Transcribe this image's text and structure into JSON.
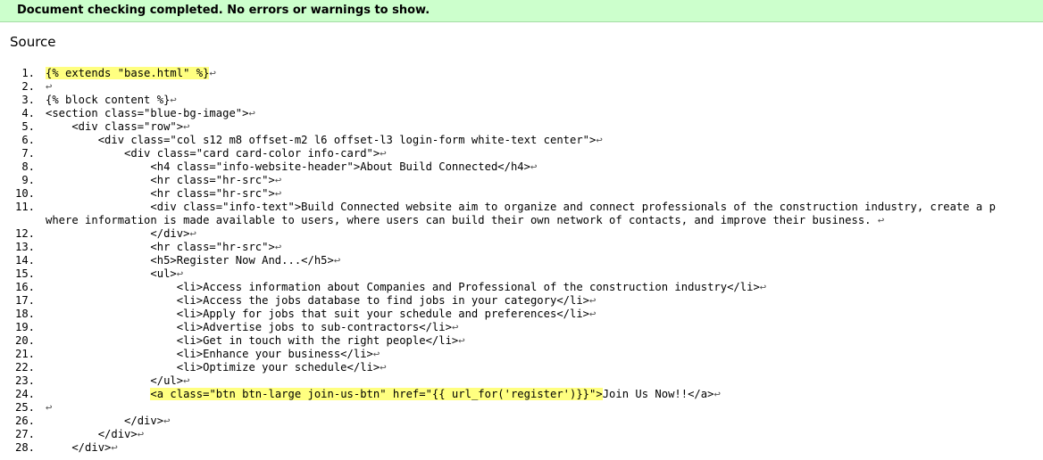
{
  "banner": {
    "message": "Document checking completed. No errors or warnings to show."
  },
  "source": {
    "heading": "Source",
    "return_glyph": "↩",
    "lines": [
      {
        "num": "1.",
        "text": "{% extends \"base.html\" %}",
        "highlight": true
      },
      {
        "num": "2.",
        "text": ""
      },
      {
        "num": "3.",
        "text": "{% block content %}"
      },
      {
        "num": "4.",
        "text": "<section class=\"blue-bg-image\">"
      },
      {
        "num": "5.",
        "text": "    <div class=\"row\">"
      },
      {
        "num": "6.",
        "text": "        <div class=\"col s12 m8 offset-m2 l6 offset-l3 login-form white-text center\">"
      },
      {
        "num": "7.",
        "text": "            <div class=\"card card-color info-card\">"
      },
      {
        "num": "8.",
        "text": "                <h4 class=\"info-website-header\">About Build Connected</h4>"
      },
      {
        "num": "9.",
        "text": "                <hr class=\"hr-src\">"
      },
      {
        "num": "10.",
        "text": "                <hr class=\"hr-src\">"
      },
      {
        "num": "11.",
        "text": "                <div class=\"info-text\">Build Connected website aim to organize and connect professionals of the construction industry, create a p",
        "continuation": "where information is made available to users, where users can build their own network of contacts, and improve their business. "
      },
      {
        "num": "12.",
        "text": "                </div>"
      },
      {
        "num": "13.",
        "text": "                <hr class=\"hr-src\">"
      },
      {
        "num": "14.",
        "text": "                <h5>Register Now And...</h5>"
      },
      {
        "num": "15.",
        "text": "                <ul>"
      },
      {
        "num": "16.",
        "text": "                    <li>Access information about Companies and Professional of the construction industry</li>"
      },
      {
        "num": "17.",
        "text": "                    <li>Access the jobs database to find jobs in your category</li>"
      },
      {
        "num": "18.",
        "text": "                    <li>Apply for jobs that suit your schedule and preferences</li>"
      },
      {
        "num": "19.",
        "text": "                    <li>Advertise jobs to sub-contractors</li>"
      },
      {
        "num": "20.",
        "text": "                    <li>Get in touch with the right people</li>"
      },
      {
        "num": "21.",
        "text": "                    <li>Enhance your business</li>"
      },
      {
        "num": "22.",
        "text": "                    <li>Optimize your schedule</li>"
      },
      {
        "num": "23.",
        "text": "                </ul>"
      },
      {
        "num": "24.",
        "text": "                <a class=\"btn btn-large join-us-btn\" href=\"{{ url_for('register')}}\">",
        "highlight_prefix": true,
        "tail": "Join Us Now!!</a>"
      },
      {
        "num": "25.",
        "text": ""
      },
      {
        "num": "26.",
        "text": "            </div>"
      },
      {
        "num": "27.",
        "text": "        </div>"
      },
      {
        "num": "28.",
        "text": "    </div>"
      }
    ]
  },
  "colors": {
    "banner_bg": "#ccffcc",
    "highlight": "#ffff80"
  }
}
